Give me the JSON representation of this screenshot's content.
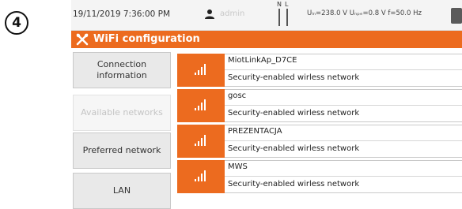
{
  "step": {
    "number": "4"
  },
  "status_bar": {
    "datetime": "19/11/2019 7:36:00 PM",
    "user_icon": "user-icon",
    "user": "admin",
    "phase_n": "N",
    "phase_l": "L",
    "measurements": "Uₗₙ=238.0 V  Uₙₚₑ=0.8 V  f=50.0 Hz",
    "battery_icon": "battery-icon"
  },
  "title_bar": {
    "icon": "tools-icon",
    "title": "WiFi configuration",
    "color": "#ec6b1f"
  },
  "sidebar": {
    "items": [
      {
        "label": "Connection information",
        "enabled": true
      },
      {
        "label": "Available networks",
        "enabled": false
      },
      {
        "label": "Preferred network",
        "enabled": true
      },
      {
        "label": "LAN",
        "enabled": true
      }
    ]
  },
  "networks": [
    {
      "ssid": "MiotLinkAp_D7CE",
      "description": "Security-enabled wirless network",
      "signal_icon": "wifi-signal-icon"
    },
    {
      "ssid": "gosc",
      "description": "Security-enabled wirless network",
      "signal_icon": "wifi-signal-icon"
    },
    {
      "ssid": "PREZENTACJA",
      "description": "Security-enabled wirless network",
      "signal_icon": "wifi-signal-icon"
    },
    {
      "ssid": "MWS",
      "description": "Security-enabled wirless network",
      "signal_icon": "wifi-signal-icon"
    }
  ]
}
